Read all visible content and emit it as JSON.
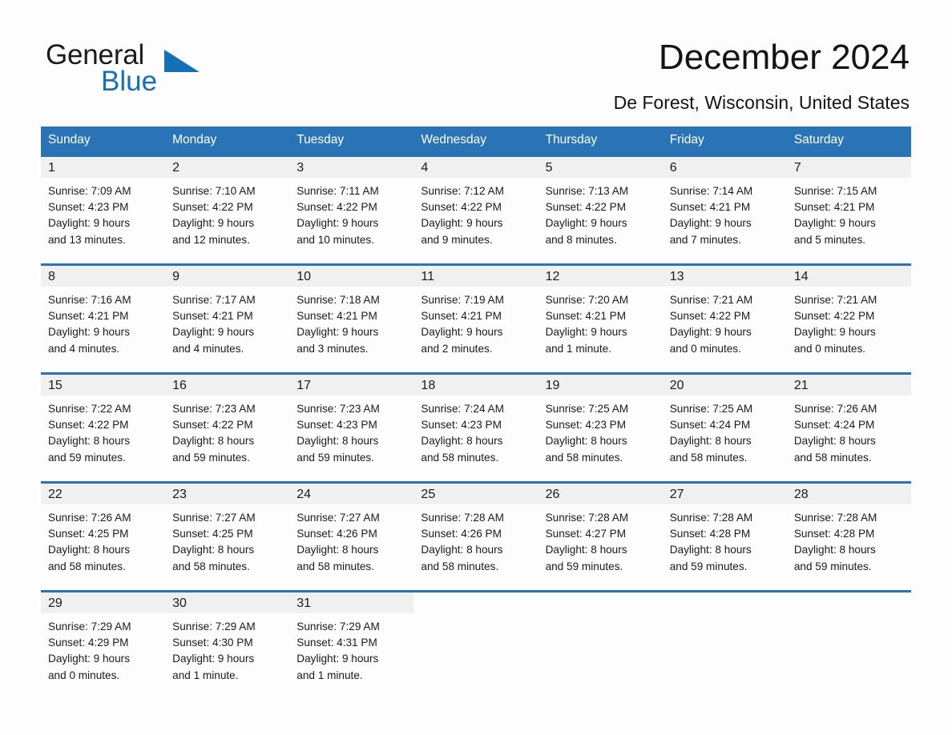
{
  "brand": {
    "name_part1": "General",
    "name_part2": "Blue",
    "triangle_color": "#1670b8",
    "blue_text_color": "#1670b8"
  },
  "header": {
    "title": "December 2024",
    "subtitle": "De Forest, Wisconsin, United States"
  },
  "theme": {
    "header_blue": "#2a74b6",
    "day_band_gray": "#f0f0f0",
    "page_background": "#fdfdfd",
    "text_color": "#1a1a1a"
  },
  "calendar": {
    "weekday_headers": [
      "Sunday",
      "Monday",
      "Tuesday",
      "Wednesday",
      "Thursday",
      "Friday",
      "Saturday"
    ],
    "weeks": [
      [
        {
          "day": "1",
          "sunrise": "Sunrise: 7:09 AM",
          "sunset": "Sunset: 4:23 PM",
          "daylight_line1": "Daylight: 9 hours",
          "daylight_line2": "and 13 minutes."
        },
        {
          "day": "2",
          "sunrise": "Sunrise: 7:10 AM",
          "sunset": "Sunset: 4:22 PM",
          "daylight_line1": "Daylight: 9 hours",
          "daylight_line2": "and 12 minutes."
        },
        {
          "day": "3",
          "sunrise": "Sunrise: 7:11 AM",
          "sunset": "Sunset: 4:22 PM",
          "daylight_line1": "Daylight: 9 hours",
          "daylight_line2": "and 10 minutes."
        },
        {
          "day": "4",
          "sunrise": "Sunrise: 7:12 AM",
          "sunset": "Sunset: 4:22 PM",
          "daylight_line1": "Daylight: 9 hours",
          "daylight_line2": "and 9 minutes."
        },
        {
          "day": "5",
          "sunrise": "Sunrise: 7:13 AM",
          "sunset": "Sunset: 4:22 PM",
          "daylight_line1": "Daylight: 9 hours",
          "daylight_line2": "and 8 minutes."
        },
        {
          "day": "6",
          "sunrise": "Sunrise: 7:14 AM",
          "sunset": "Sunset: 4:21 PM",
          "daylight_line1": "Daylight: 9 hours",
          "daylight_line2": "and 7 minutes."
        },
        {
          "day": "7",
          "sunrise": "Sunrise: 7:15 AM",
          "sunset": "Sunset: 4:21 PM",
          "daylight_line1": "Daylight: 9 hours",
          "daylight_line2": "and 5 minutes."
        }
      ],
      [
        {
          "day": "8",
          "sunrise": "Sunrise: 7:16 AM",
          "sunset": "Sunset: 4:21 PM",
          "daylight_line1": "Daylight: 9 hours",
          "daylight_line2": "and 4 minutes."
        },
        {
          "day": "9",
          "sunrise": "Sunrise: 7:17 AM",
          "sunset": "Sunset: 4:21 PM",
          "daylight_line1": "Daylight: 9 hours",
          "daylight_line2": "and 4 minutes."
        },
        {
          "day": "10",
          "sunrise": "Sunrise: 7:18 AM",
          "sunset": "Sunset: 4:21 PM",
          "daylight_line1": "Daylight: 9 hours",
          "daylight_line2": "and 3 minutes."
        },
        {
          "day": "11",
          "sunrise": "Sunrise: 7:19 AM",
          "sunset": "Sunset: 4:21 PM",
          "daylight_line1": "Daylight: 9 hours",
          "daylight_line2": "and 2 minutes."
        },
        {
          "day": "12",
          "sunrise": "Sunrise: 7:20 AM",
          "sunset": "Sunset: 4:21 PM",
          "daylight_line1": "Daylight: 9 hours",
          "daylight_line2": "and 1 minute."
        },
        {
          "day": "13",
          "sunrise": "Sunrise: 7:21 AM",
          "sunset": "Sunset: 4:22 PM",
          "daylight_line1": "Daylight: 9 hours",
          "daylight_line2": "and 0 minutes."
        },
        {
          "day": "14",
          "sunrise": "Sunrise: 7:21 AM",
          "sunset": "Sunset: 4:22 PM",
          "daylight_line1": "Daylight: 9 hours",
          "daylight_line2": "and 0 minutes."
        }
      ],
      [
        {
          "day": "15",
          "sunrise": "Sunrise: 7:22 AM",
          "sunset": "Sunset: 4:22 PM",
          "daylight_line1": "Daylight: 8 hours",
          "daylight_line2": "and 59 minutes."
        },
        {
          "day": "16",
          "sunrise": "Sunrise: 7:23 AM",
          "sunset": "Sunset: 4:22 PM",
          "daylight_line1": "Daylight: 8 hours",
          "daylight_line2": "and 59 minutes."
        },
        {
          "day": "17",
          "sunrise": "Sunrise: 7:23 AM",
          "sunset": "Sunset: 4:23 PM",
          "daylight_line1": "Daylight: 8 hours",
          "daylight_line2": "and 59 minutes."
        },
        {
          "day": "18",
          "sunrise": "Sunrise: 7:24 AM",
          "sunset": "Sunset: 4:23 PM",
          "daylight_line1": "Daylight: 8 hours",
          "daylight_line2": "and 58 minutes."
        },
        {
          "day": "19",
          "sunrise": "Sunrise: 7:25 AM",
          "sunset": "Sunset: 4:23 PM",
          "daylight_line1": "Daylight: 8 hours",
          "daylight_line2": "and 58 minutes."
        },
        {
          "day": "20",
          "sunrise": "Sunrise: 7:25 AM",
          "sunset": "Sunset: 4:24 PM",
          "daylight_line1": "Daylight: 8 hours",
          "daylight_line2": "and 58 minutes."
        },
        {
          "day": "21",
          "sunrise": "Sunrise: 7:26 AM",
          "sunset": "Sunset: 4:24 PM",
          "daylight_line1": "Daylight: 8 hours",
          "daylight_line2": "and 58 minutes."
        }
      ],
      [
        {
          "day": "22",
          "sunrise": "Sunrise: 7:26 AM",
          "sunset": "Sunset: 4:25 PM",
          "daylight_line1": "Daylight: 8 hours",
          "daylight_line2": "and 58 minutes."
        },
        {
          "day": "23",
          "sunrise": "Sunrise: 7:27 AM",
          "sunset": "Sunset: 4:25 PM",
          "daylight_line1": "Daylight: 8 hours",
          "daylight_line2": "and 58 minutes."
        },
        {
          "day": "24",
          "sunrise": "Sunrise: 7:27 AM",
          "sunset": "Sunset: 4:26 PM",
          "daylight_line1": "Daylight: 8 hours",
          "daylight_line2": "and 58 minutes."
        },
        {
          "day": "25",
          "sunrise": "Sunrise: 7:28 AM",
          "sunset": "Sunset: 4:26 PM",
          "daylight_line1": "Daylight: 8 hours",
          "daylight_line2": "and 58 minutes."
        },
        {
          "day": "26",
          "sunrise": "Sunrise: 7:28 AM",
          "sunset": "Sunset: 4:27 PM",
          "daylight_line1": "Daylight: 8 hours",
          "daylight_line2": "and 59 minutes."
        },
        {
          "day": "27",
          "sunrise": "Sunrise: 7:28 AM",
          "sunset": "Sunset: 4:28 PM",
          "daylight_line1": "Daylight: 8 hours",
          "daylight_line2": "and 59 minutes."
        },
        {
          "day": "28",
          "sunrise": "Sunrise: 7:28 AM",
          "sunset": "Sunset: 4:28 PM",
          "daylight_line1": "Daylight: 8 hours",
          "daylight_line2": "and 59 minutes."
        }
      ],
      [
        {
          "day": "29",
          "sunrise": "Sunrise: 7:29 AM",
          "sunset": "Sunset: 4:29 PM",
          "daylight_line1": "Daylight: 9 hours",
          "daylight_line2": "and 0 minutes."
        },
        {
          "day": "30",
          "sunrise": "Sunrise: 7:29 AM",
          "sunset": "Sunset: 4:30 PM",
          "daylight_line1": "Daylight: 9 hours",
          "daylight_line2": "and 1 minute."
        },
        {
          "day": "31",
          "sunrise": "Sunrise: 7:29 AM",
          "sunset": "Sunset: 4:31 PM",
          "daylight_line1": "Daylight: 9 hours",
          "daylight_line2": "and 1 minute."
        },
        {
          "day": "",
          "sunrise": "",
          "sunset": "",
          "daylight_line1": "",
          "daylight_line2": ""
        },
        {
          "day": "",
          "sunrise": "",
          "sunset": "",
          "daylight_line1": "",
          "daylight_line2": ""
        },
        {
          "day": "",
          "sunrise": "",
          "sunset": "",
          "daylight_line1": "",
          "daylight_line2": ""
        },
        {
          "day": "",
          "sunrise": "",
          "sunset": "",
          "daylight_line1": "",
          "daylight_line2": ""
        }
      ]
    ]
  }
}
